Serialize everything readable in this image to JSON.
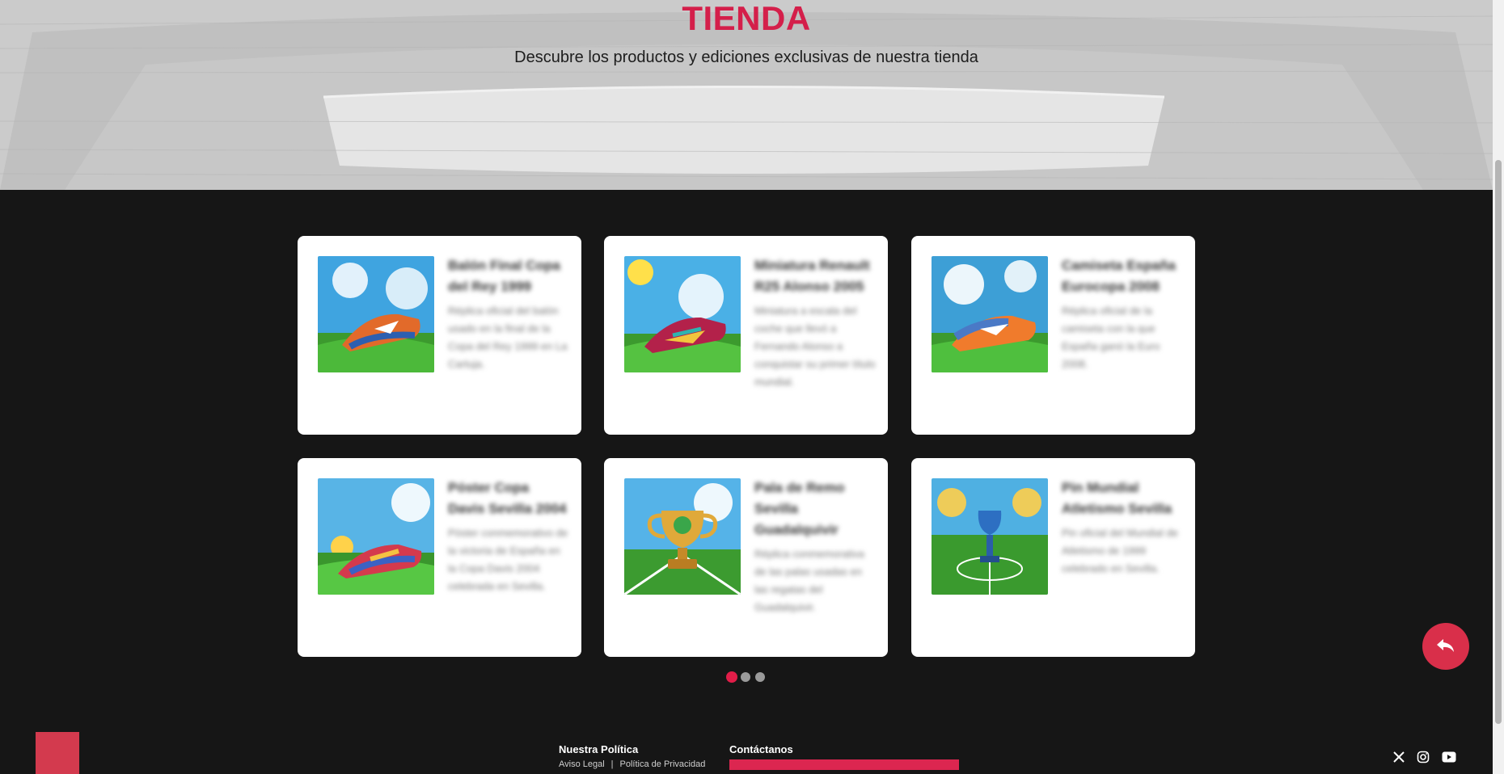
{
  "hero": {
    "title": "TIENDA",
    "subtitle": "Descubre los productos y ediciones exclusivas de nuestra tienda"
  },
  "products": [
    {
      "title": "Balón Final Copa del Rey 1999",
      "description": "Réplica oficial del balón usado en la final de la Copa del Rey 1999 en La Cartuja.",
      "image": "boot-icon"
    },
    {
      "title": "Miniatura Renault R25 Alonso 2005",
      "description": "Miniatura a escala del coche que llevó a Fernando Alonso a conquistar su primer título mundial.",
      "image": "boot-icon"
    },
    {
      "title": "Camiseta España Eurocopa 2008",
      "description": "Réplica oficial de la camiseta con la que España ganó la Euro 2008.",
      "image": "boot-icon"
    },
    {
      "title": "Póster Copa Davis Sevilla 2004",
      "description": "Póster conmemorativo de la victoria de España en la Copa Davis 2004 celebrada en Sevilla.",
      "image": "boot-icon"
    },
    {
      "title": "Pala de Remo Sevilla Guadalquivir",
      "description": "Réplica conmemorativa de las palas usadas en las regatas del Guadalquivir.",
      "image": "trophy-icon"
    },
    {
      "title": "Pin Mundial Atletismo Sevilla",
      "description": "Pin oficial del Mundial de Atletismo de 1999 celebrado en Sevilla.",
      "image": "trophy-icon"
    }
  ],
  "carousel": {
    "pages": 3,
    "active": 0
  },
  "colors": {
    "accent": "#e11d48",
    "background": "#161616",
    "card": "#ffffff"
  },
  "footer": {
    "policy_heading": "Nuestra Política",
    "legal_link": "Aviso Legal",
    "separator": "|",
    "privacy_link": "Política de Privacidad",
    "contact_heading": "Contáctanos"
  },
  "social": [
    "x-icon",
    "instagram-icon",
    "youtube-icon"
  ]
}
